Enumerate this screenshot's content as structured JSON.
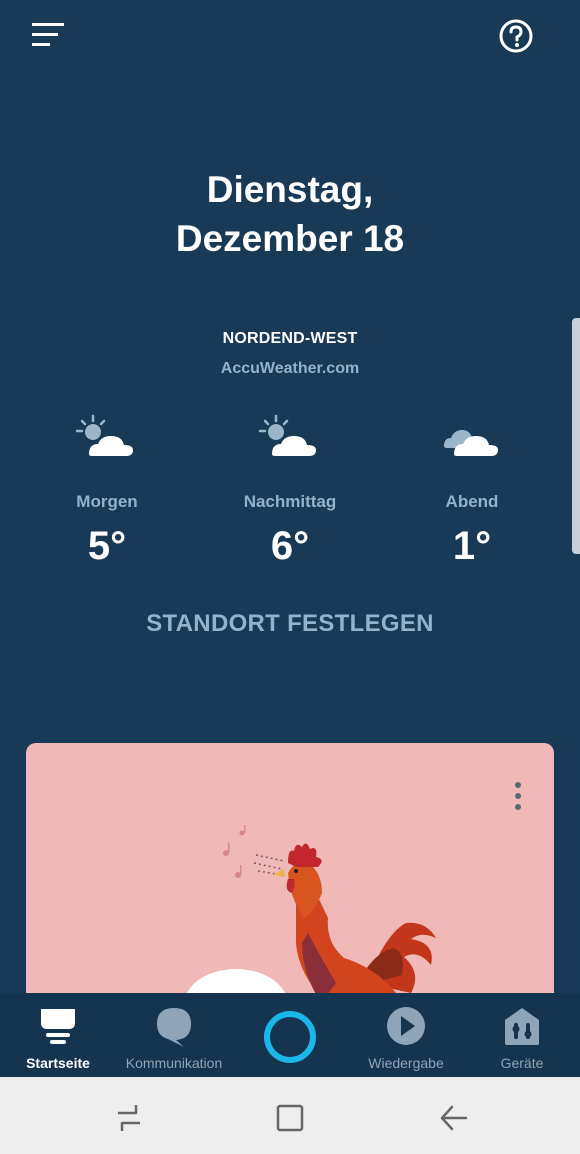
{
  "header": {
    "menu_icon": "hamburger-menu-icon",
    "help_icon": "help-circle-icon"
  },
  "date": {
    "line1": "Dienstag,",
    "line2": "Dezember 18"
  },
  "weather": {
    "location": "NORDEND-WEST",
    "provider": "AccuWeather.com",
    "forecasts": [
      {
        "period": "Morgen",
        "temp": "5°",
        "icon": "partly-sunny-icon"
      },
      {
        "period": "Nachmittag",
        "temp": "6°",
        "icon": "partly-sunny-icon"
      },
      {
        "period": "Abend",
        "temp": "1°",
        "icon": "cloudy-icon"
      }
    ],
    "set_location_label": "STANDORT FESTLEGEN"
  },
  "card": {
    "menu_icon": "more-vertical-icon",
    "illustration": "rooster-illustration"
  },
  "bottom_nav": {
    "items": [
      {
        "label": "Startseite",
        "icon": "home-icon",
        "active": true
      },
      {
        "label": "Kommunikation",
        "icon": "chat-bubble-icon",
        "active": false
      },
      {
        "label": "",
        "icon": "alexa-ring-icon",
        "active": false
      },
      {
        "label": "Wiedergabe",
        "icon": "play-icon",
        "active": false
      },
      {
        "label": "Geräte",
        "icon": "devices-icon",
        "active": false
      }
    ]
  },
  "system_nav": {
    "recents_icon": "recents-icon",
    "home_icon": "square-home-icon",
    "back_icon": "back-arrow-icon"
  },
  "colors": {
    "background": "#183a56",
    "accent_text": "#8fb4cc",
    "card": "#f0b9b7",
    "alexa": "#1ab8e8"
  }
}
